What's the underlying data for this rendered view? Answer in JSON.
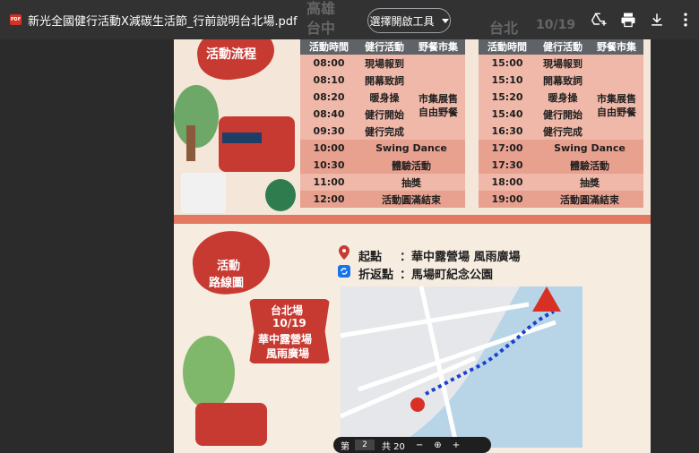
{
  "toolbar": {
    "pdf_badge": "PDF",
    "filename": "新光全國健行活動X減碳生活節_行前說明台北場.pdf",
    "open_with": "選擇開啟工具",
    "ghost_left_city": "高雄",
    "ghost_left_city2": "台中",
    "ghost_right_city": "台北",
    "ghost_right_date": "10/19"
  },
  "schedule": {
    "badge": "活動流程",
    "headers": [
      "活動時間",
      "健行活動",
      "野餐市集"
    ],
    "left_rows": [
      {
        "time": "08:00",
        "activity": "現場報到"
      },
      {
        "time": "08:10",
        "activity": "開幕致詞"
      },
      {
        "time": "08:20",
        "activity": "暖身操"
      },
      {
        "time": "08:40",
        "activity": "健行開始"
      },
      {
        "time": "09:30",
        "activity": "健行完成"
      },
      {
        "time": "10:00",
        "activity": "Swing Dance"
      },
      {
        "time": "10:30",
        "activity": "體驗活動"
      },
      {
        "time": "11:00",
        "activity": "抽獎"
      },
      {
        "time": "12:00",
        "activity": "活動圓滿結束"
      }
    ],
    "right_rows": [
      {
        "time": "15:00",
        "activity": "現場報到"
      },
      {
        "time": "15:10",
        "activity": "開幕致詞"
      },
      {
        "time": "15:20",
        "activity": "暖身操"
      },
      {
        "time": "15:40",
        "activity": "健行開始"
      },
      {
        "time": "16:30",
        "activity": "健行完成"
      },
      {
        "time": "17:00",
        "activity": "Swing Dance"
      },
      {
        "time": "17:30",
        "activity": "體驗活動"
      },
      {
        "time": "18:00",
        "activity": "抽獎"
      },
      {
        "time": "19:00",
        "activity": "活動圓滿結束"
      }
    ],
    "market": "市集展售\n自由野餐"
  },
  "route": {
    "badge_line1": "活動",
    "badge_line2": "路線圖",
    "event_line1": "台北場",
    "event_line2": "10/19",
    "event_line3": "華中露營場",
    "event_line4": "風雨廣場",
    "start_label": "起點",
    "start_value": "：華中露營場 風雨廣場",
    "turn_label": "折返點",
    "turn_value": "：馬場町紀念公園"
  },
  "pager": {
    "page_label": "第",
    "current": "2",
    "total": "共 20",
    "minus": "−",
    "plus": "+"
  },
  "icons": [
    "pdf-icon",
    "add-to-drive-icon",
    "print-icon",
    "download-icon",
    "more-vert-icon",
    "location-pin-icon",
    "refresh-icon",
    "zoom-icon"
  ]
}
